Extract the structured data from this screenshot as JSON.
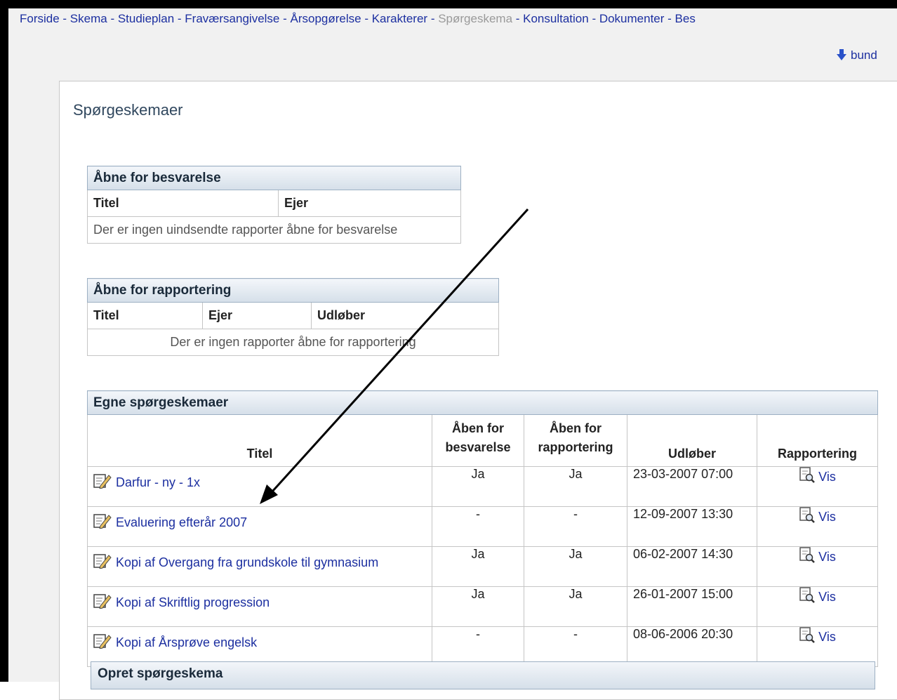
{
  "nav": {
    "items": [
      {
        "label": "Forside",
        "current": false
      },
      {
        "label": "Skema",
        "current": false
      },
      {
        "label": "Studieplan",
        "current": false
      },
      {
        "label": "Fraværsangivelse",
        "current": false
      },
      {
        "label": "Årsopgørelse",
        "current": false
      },
      {
        "label": "Karakterer",
        "current": false
      },
      {
        "label": "Spørgeskema",
        "current": true
      },
      {
        "label": "Konsultation",
        "current": false
      },
      {
        "label": "Dokumenter",
        "current": false
      },
      {
        "label": "Bes",
        "current": false
      }
    ],
    "separator": " - "
  },
  "bund_link": "bund",
  "page_title": "Spørgeskemaer",
  "open_answer": {
    "caption": "Åbne for besvarelse",
    "headers": [
      "Titel",
      "Ejer"
    ],
    "empty_text": "Der er ingen uindsendte rapporter åbne for besvarelse"
  },
  "open_report": {
    "caption": "Åbne for rapportering",
    "headers": [
      "Titel",
      "Ejer",
      "Udløber"
    ],
    "empty_text": "Der er ingen rapporter åbne for rapportering"
  },
  "own": {
    "caption": "Egne spørgeskemaer",
    "headers": {
      "titel": "Titel",
      "aaben_besvarelse": "Åben for besvarelse",
      "aaben_rapportering": "Åben for rapportering",
      "udloeber": "Udløber",
      "rapportering": "Rapportering"
    },
    "rows": [
      {
        "title": "Darfur - ny - 1x",
        "besvarelse": "Ja",
        "rapportering": "Ja",
        "udloeber": "23-03-2007 07:00",
        "action": "Vis"
      },
      {
        "title": "Evaluering efterår 2007",
        "besvarelse": "-",
        "rapportering": "-",
        "udloeber": "12-09-2007 13:30",
        "action": "Vis"
      },
      {
        "title": "Kopi af Overgang fra grundskole til gymnasium",
        "besvarelse": "Ja",
        "rapportering": "Ja",
        "udloeber": "06-02-2007 14:30",
        "action": "Vis"
      },
      {
        "title": "Kopi af Skriftlig progression",
        "besvarelse": "Ja",
        "rapportering": "Ja",
        "udloeber": "26-01-2007 15:00",
        "action": "Vis"
      },
      {
        "title": "Kopi af Årsprøve engelsk",
        "besvarelse": "-",
        "rapportering": "-",
        "udloeber": "08-06-2006 20:30",
        "action": "Vis"
      }
    ]
  },
  "create_caption": "Opret spørgeskema"
}
